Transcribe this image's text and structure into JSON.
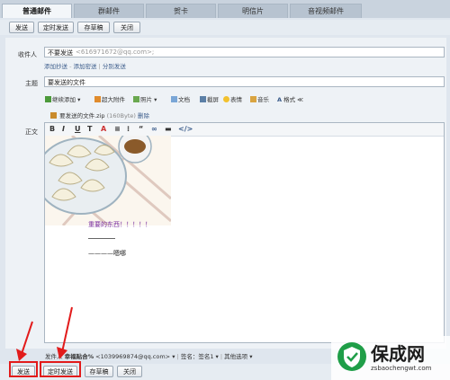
{
  "tabs": [
    "普通邮件",
    "群邮件",
    "贺卡",
    "明信片",
    "音视频邮件"
  ],
  "top_toolbar": [
    "发送",
    "定时发送",
    "存草稿",
    "关闭"
  ],
  "bottom_toolbar": [
    "发送",
    "定时发送",
    "存草稿",
    "关闭"
  ],
  "recipient": {
    "label": "收件人",
    "name": "不要发送",
    "email": "<616971672@qq.com>;"
  },
  "recipient_links": [
    "添加抄送",
    "添加密送",
    "分别发送"
  ],
  "subject": {
    "label": "主题",
    "value": "要发送的文件"
  },
  "attach_tools": [
    "继续添加",
    "超大附件",
    "照片",
    "文档",
    "截屏",
    "表情",
    "音乐",
    "格式"
  ],
  "attachment": {
    "name": "要发送的文件.zip",
    "size": "(160Byte)",
    "delete": "删除"
  },
  "body_label": "正文",
  "editor_tools": [
    "B",
    "I",
    "U",
    "T",
    "A",
    "≡",
    "⁝",
    "“",
    "∞",
    "▬",
    "</>"
  ],
  "body_text": {
    "red": "重要的东西！！！！！",
    "signature_line": "————",
    "signature": "————嗯哪"
  },
  "sender": {
    "label": "发件人",
    "name": "幸福贴合%",
    "email": "<1039969874@qq.com>",
    "signature": "签名：签名1",
    "more": "其他选项"
  },
  "watermark": {
    "brand": "保成网",
    "url": "zsbaochengwt.com"
  },
  "colors": {
    "accent": "#e21b1b",
    "link": "#3a5b8a"
  }
}
